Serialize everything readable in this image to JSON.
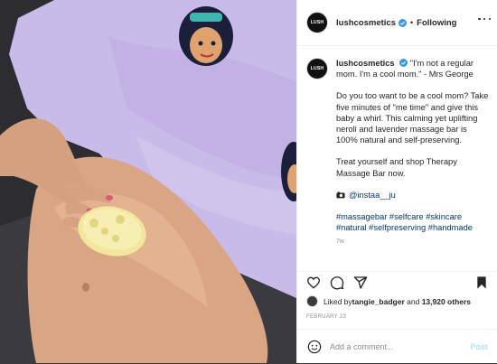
{
  "account": {
    "avatar_text": "LUSH",
    "username": "lushcosmetics",
    "separator": "•",
    "follow_label": "Following"
  },
  "caption": {
    "username": "lushcosmetics",
    "quote": "\"I'm not a regular mom. I'm a cool mom.\" - Mrs George",
    "paragraph1": "Do you too want to be a cool mom? Take five minutes of \"me time\" and give this baby a whirl. This calming yet uplifting neroli and lavender massage bar is 100% natural and self-preserving.",
    "paragraph2": "Treat yourself and shop Therapy Massage Bar now.",
    "credit": "@instaa__ju",
    "hashtags": "#massagebar #selfcare #skincare #natural #selfpreserving #handmade",
    "time_ago": "7w"
  },
  "likes": {
    "prefix": "Liked by ",
    "first_user": "tangie_badger",
    "middle": " and ",
    "others": "13,920 others"
  },
  "date": "FEBRUARY 23",
  "comment": {
    "placeholder": "Add a comment...",
    "post_label": "Post"
  },
  "icons": {
    "like": "heart-icon",
    "comment": "comment-icon",
    "share": "share-icon",
    "save": "bookmark-icon",
    "emoji": "emoji-icon",
    "more": "more-options-icon",
    "verified": "verified-badge-icon",
    "camera": "camera-icon"
  },
  "colors": {
    "link": "#00376b",
    "verified": "#3897f0",
    "post_disabled": "#b2dffc",
    "sweater": "#c7b8e8"
  }
}
